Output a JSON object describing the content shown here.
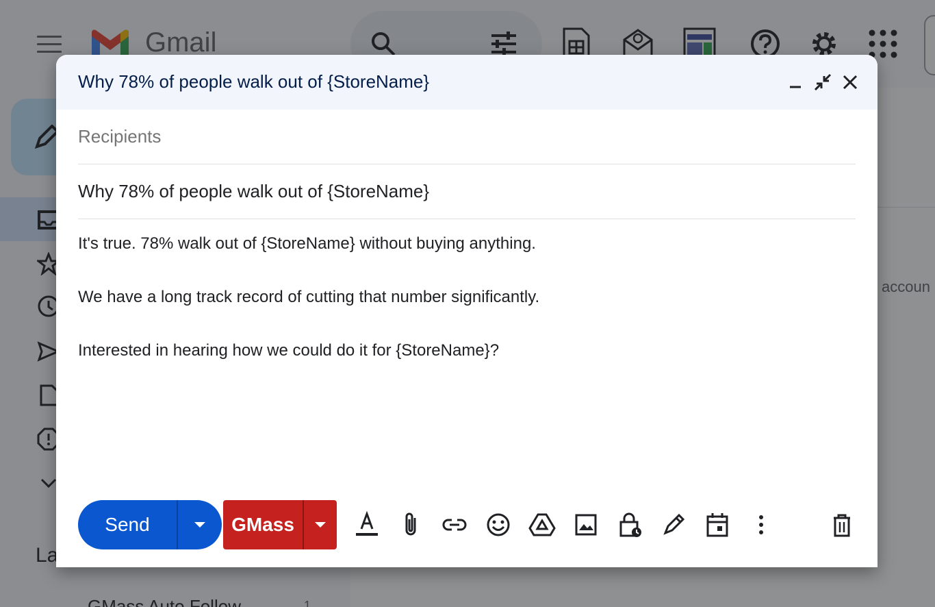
{
  "background": {
    "app_name": "Gmail",
    "labels_heading": "La",
    "bottom_label": "GMass Auto Follow",
    "bottom_count": "1",
    "account_text": "accoun"
  },
  "compose": {
    "title": "Why 78% of people walk out of {StoreName}",
    "recipients_placeholder": "Recipients",
    "subject": "Why 78% of people walk out of {StoreName}",
    "body_lines": [
      "It's true. 78% walk out of {StoreName} without buying anything.",
      "We have a long track record of cutting that number significantly.",
      "Interested in hearing how we could do it for {StoreName}?"
    ]
  },
  "toolbar": {
    "send_label": "Send",
    "gmass_label": "GMass"
  },
  "icons": {
    "header": [
      "minimize-icon",
      "exit-fullscreen-icon",
      "close-icon"
    ],
    "toolbar": [
      "text-format-icon",
      "attach-icon",
      "link-icon",
      "emoji-icon",
      "drive-icon",
      "photo-icon",
      "confidential-icon",
      "signature-icon",
      "schedule-icon",
      "more-options-icon",
      "trash-icon"
    ]
  },
  "colors": {
    "send_blue": "#0b57d0",
    "gmass_red": "#c5221f",
    "header_bg": "#f2f6fc",
    "title_color": "#041e49"
  }
}
